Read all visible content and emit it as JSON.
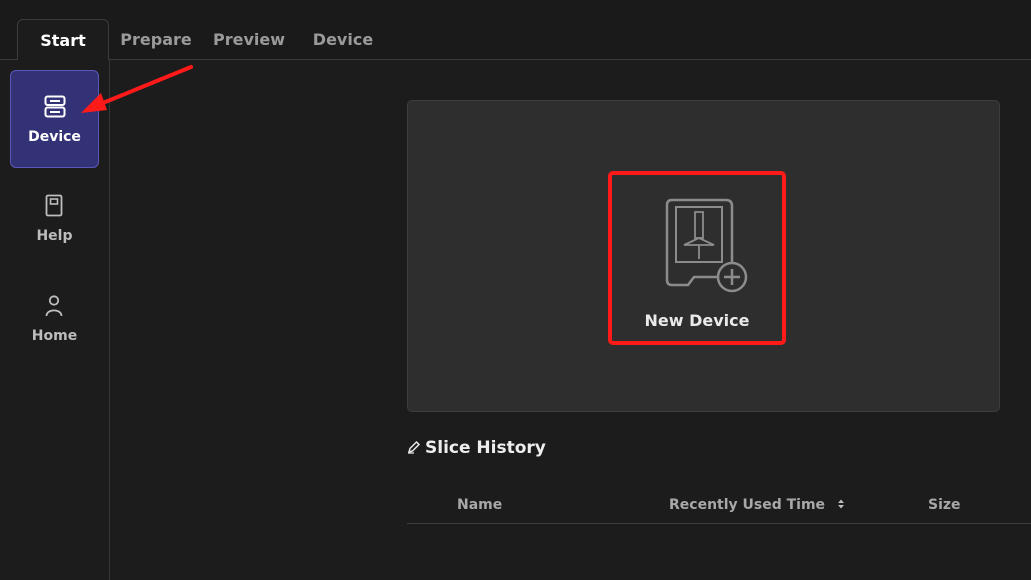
{
  "tabs": [
    {
      "label": "Start",
      "active": true
    },
    {
      "label": "Prepare",
      "active": false
    },
    {
      "label": "Preview",
      "active": false
    },
    {
      "label": "Device",
      "active": false
    }
  ],
  "sidebar": {
    "items": [
      {
        "label": "Device",
        "icon": "device-icon",
        "active": true
      },
      {
        "label": "Help",
        "icon": "help-book-icon",
        "active": false
      },
      {
        "label": "Home",
        "icon": "home-user-icon",
        "active": false
      }
    ]
  },
  "main": {
    "new_device_label": "New Device",
    "slice_history_title": "Slice History",
    "table_headers": [
      "Name",
      "Recently Used Time",
      "Size"
    ]
  },
  "colors": {
    "accent": "#343276",
    "highlight": "#ff1a1a",
    "background": "#1c1c1c",
    "panel": "#2e2e2e"
  }
}
